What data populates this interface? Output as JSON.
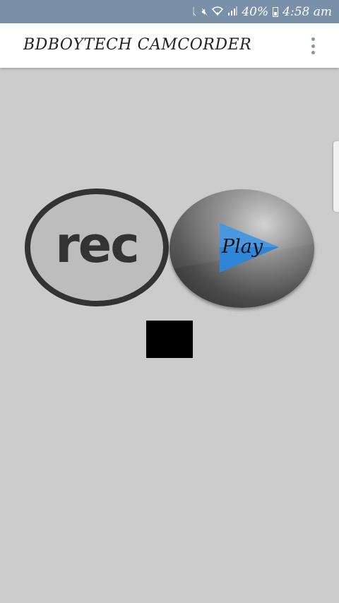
{
  "status_bar": {
    "battery_percent": "40%",
    "time": "4:58 am",
    "icons": [
      "bluetooth-icon",
      "mute-icon",
      "wifi-icon",
      "signal-icon",
      "battery-icon"
    ]
  },
  "app_bar": {
    "title": "BDBOYTECH CAMCORDER",
    "overflow_icon": "more-vert-icon"
  },
  "main": {
    "rec_label": "rec",
    "play_label": "Play",
    "stop_icon": "stop-icon"
  },
  "colors": {
    "status_bar": "#7a8fa8",
    "background": "#cccccc",
    "play_triangle": "#2f86d6",
    "rec_ring": "#333333"
  }
}
